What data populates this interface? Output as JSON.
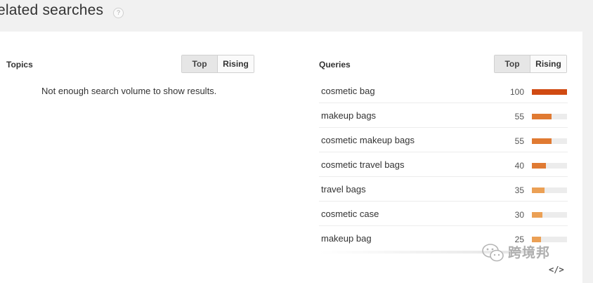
{
  "header": {
    "title": "elated searches",
    "help_glyph": "?"
  },
  "topics": {
    "title": "Topics",
    "toggle": {
      "top_label": "Top",
      "rising_label": "Rising",
      "selected": "Top"
    },
    "empty_message": "Not enough search volume to show results."
  },
  "queries": {
    "title": "Queries",
    "toggle": {
      "top_label": "Top",
      "rising_label": "Rising",
      "selected": "Top"
    },
    "max_value": 100,
    "items": [
      {
        "label": "cosmetic bag",
        "value": 100,
        "color": "#d04a12"
      },
      {
        "label": "makeup bags",
        "value": 55,
        "color": "#e07a32"
      },
      {
        "label": "cosmetic makeup bags",
        "value": 55,
        "color": "#e07a32"
      },
      {
        "label": "cosmetic travel bags",
        "value": 40,
        "color": "#e07a32"
      },
      {
        "label": "travel bags",
        "value": 35,
        "color": "#eba055"
      },
      {
        "label": "cosmetic case",
        "value": 30,
        "color": "#eba055"
      },
      {
        "label": "makeup bag",
        "value": 25,
        "color": "#eba055"
      }
    ]
  },
  "watermark": {
    "text": "跨境邦",
    "icon": "wechat-logo"
  },
  "embed": {
    "glyph": "</>",
    "icon": "embed-code-icon"
  }
}
